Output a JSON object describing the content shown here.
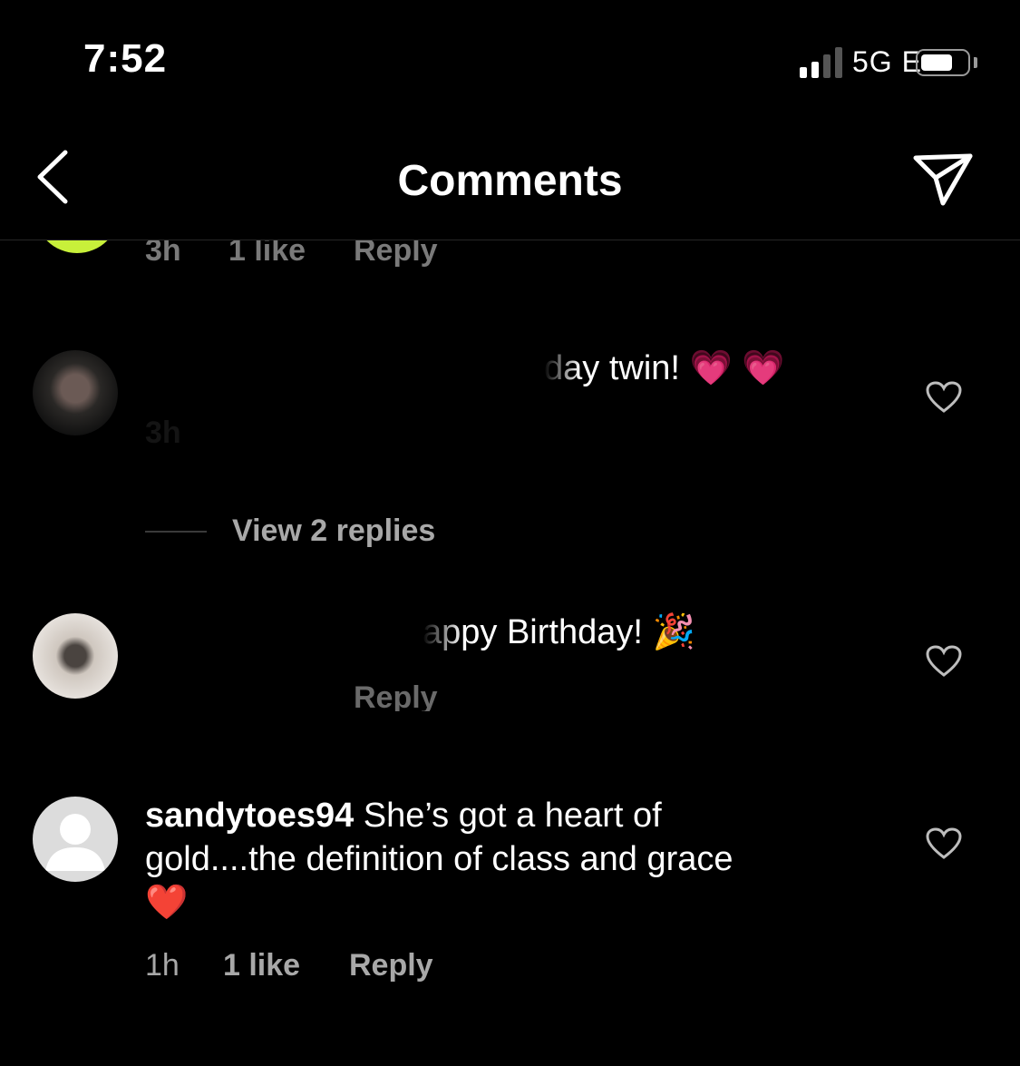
{
  "status_bar": {
    "time": "7:52",
    "network": "5G E"
  },
  "header": {
    "title": "Comments"
  },
  "comments": [
    {
      "meta": {
        "time": "3h",
        "likes": "1 like",
        "reply": "Reply"
      }
    },
    {
      "text": "day twin! 💗 💗",
      "meta_time": "3h",
      "view_replies": "View 2 replies"
    },
    {
      "text": "appy Birthday! 🎉",
      "reply": "Reply"
    },
    {
      "username": "sandytoes94",
      "text": "She’s got a heart of",
      "text_line2": "gold....the definition of class and grace",
      "emoji": "❤️",
      "meta": {
        "time": "1h",
        "likes": "1 like",
        "reply": "Reply"
      }
    }
  ],
  "colors": {
    "background": "#000000",
    "text": "#ffffff",
    "meta": "#a8a8a8",
    "divider": "#262626"
  }
}
